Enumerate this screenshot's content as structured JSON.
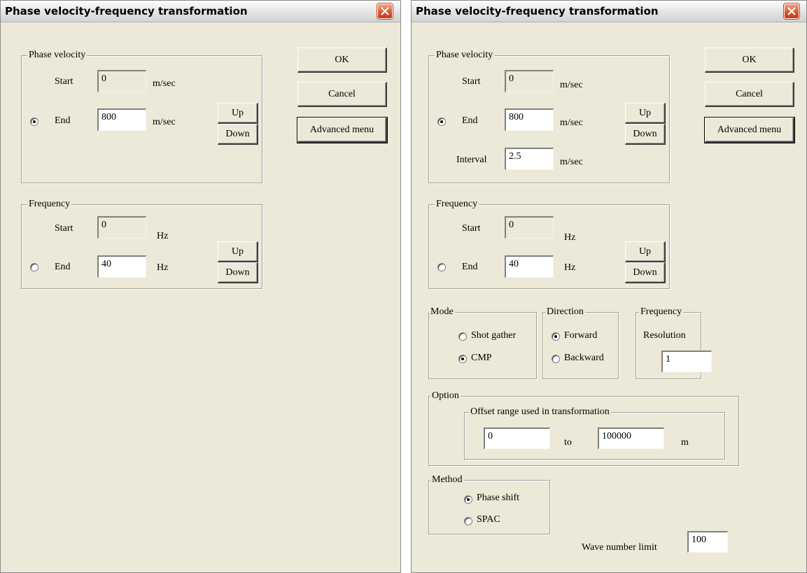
{
  "left": {
    "title": "Phase velocity-frequency transformation",
    "phase_velocity": {
      "label": "Phase velocity",
      "start_label": "Start",
      "start_value": "0",
      "start_unit": "m/sec",
      "end_label": "End",
      "end_value": "800",
      "end_unit": "m/sec",
      "end_selected": true
    },
    "frequency": {
      "label": "Frequency",
      "start_label": "Start",
      "start_value": "0",
      "start_unit": "Hz",
      "end_label": "End",
      "end_value": "40",
      "end_unit": "Hz",
      "end_selected": false
    },
    "buttons": {
      "ok": "OK",
      "cancel": "Cancel",
      "advanced": "Advanced menu",
      "up": "Up",
      "down": "Down"
    }
  },
  "right": {
    "title": "Phase velocity-frequency transformation",
    "phase_velocity": {
      "label": "Phase velocity",
      "start_label": "Start",
      "start_value": "0",
      "start_unit": "m/sec",
      "end_label": "End",
      "end_value": "800",
      "end_unit": "m/sec",
      "interval_label": "Interval",
      "interval_value": "2.5",
      "interval_unit": "m/sec",
      "end_selected": true
    },
    "frequency": {
      "label": "Frequency",
      "start_label": "Start",
      "start_value": "0",
      "start_unit": "Hz",
      "end_label": "End",
      "end_value": "40",
      "end_unit": "Hz",
      "end_selected": false
    },
    "mode": {
      "label": "Mode",
      "shot_gather": "Shot gather",
      "cmp": "CMP",
      "selected": "CMP"
    },
    "direction": {
      "label": "Direction",
      "forward": "Forward",
      "backward": "Backward",
      "selected": "Forward"
    },
    "freq_resolution": {
      "label": "Frequency",
      "sublabel": "Resolution",
      "value": "1"
    },
    "option": {
      "label": "Option",
      "offset_label": "Offset range used in transformation",
      "from_value": "0",
      "to_label": "to",
      "to_value": "100000",
      "unit": "m"
    },
    "method": {
      "label": "Method",
      "phase_shift": "Phase shift",
      "spac": "SPAC",
      "selected": "Phase shift"
    },
    "wave_number_limit": {
      "label": "Wave number limit",
      "value": "100"
    },
    "buttons": {
      "ok": "OK",
      "cancel": "Cancel",
      "advanced": "Advanced menu",
      "up": "Up",
      "down": "Down"
    }
  }
}
